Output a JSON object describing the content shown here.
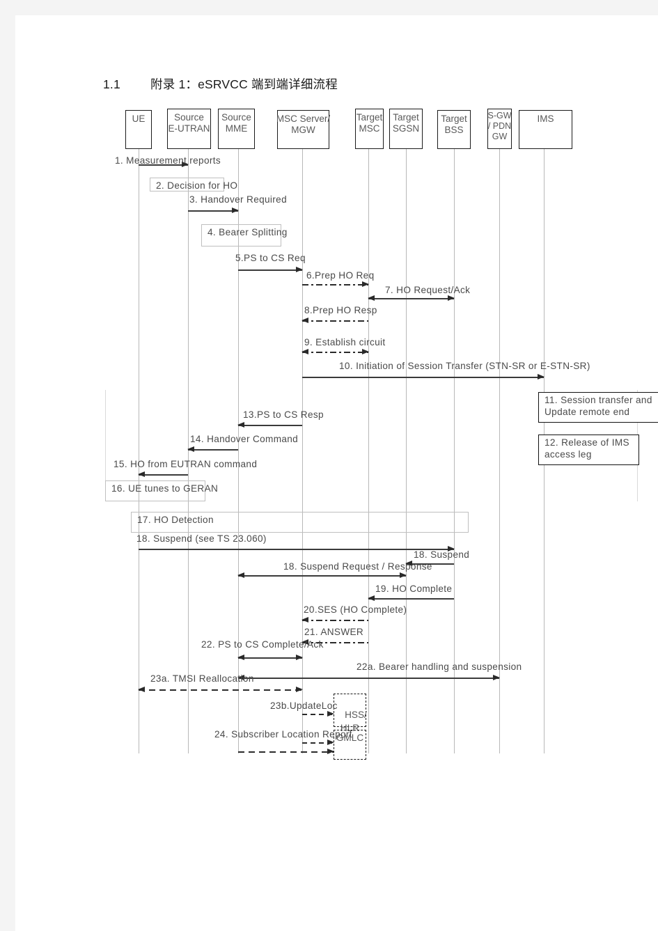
{
  "page": {
    "heading_number": "1.1",
    "heading_text": "附录 1：eSRVCC 端到端详细流程"
  },
  "actors": [
    {
      "name": "ue",
      "label": "UE"
    },
    {
      "name": "source-eutran",
      "label": "Source\nE-UTRAN"
    },
    {
      "name": "source-mme",
      "label": "Source\nMME"
    },
    {
      "name": "msc-server-mgw",
      "label": "MSC Server/\nMGW"
    },
    {
      "name": "target-msc",
      "label": "Target\nMSC"
    },
    {
      "name": "target-sgsn",
      "label": "Target\nSGSN"
    },
    {
      "name": "target-bss",
      "label": "Target\nBSS"
    },
    {
      "name": "sgw-pdngw",
      "label": "S-GW\n/ PDN\nGW"
    },
    {
      "name": "ims",
      "label": "IMS"
    }
  ],
  "extra_nodes": [
    {
      "name": "hss-hlr",
      "label": "HSS/\nHLR"
    },
    {
      "name": "gmlc",
      "label": "GMLC"
    }
  ],
  "messages": [
    {
      "id": "m1",
      "label": "1. Measurement reports"
    },
    {
      "id": "m3",
      "label": "3. Handover Required"
    },
    {
      "id": "m5",
      "label": "5.PS to CS Req"
    },
    {
      "id": "m6",
      "label": "6.Prep HO Req"
    },
    {
      "id": "m7",
      "label": "7. HO Request/Ack"
    },
    {
      "id": "m8",
      "label": "8.Prep HO Resp"
    },
    {
      "id": "m9",
      "label": "9. Establish circuit"
    },
    {
      "id": "m10",
      "label": "10. Initiation of Session Transfer (STN-SR or E-STN-SR)"
    },
    {
      "id": "m13",
      "label": "13.PS to CS Resp"
    },
    {
      "id": "m14",
      "label": "14. Handover Command"
    },
    {
      "id": "m15",
      "label": "15. HO from EUTRAN command"
    },
    {
      "id": "m18a",
      "label": "18. Suspend (see TS 23.060)"
    },
    {
      "id": "m18b",
      "label": "18. Suspend"
    },
    {
      "id": "m18c",
      "label": "18. Suspend Request / Response"
    },
    {
      "id": "m19",
      "label": "19. HO Complete"
    },
    {
      "id": "m20",
      "label": "20.SES (HO Complete)"
    },
    {
      "id": "m21",
      "label": "21. ANSWER"
    },
    {
      "id": "m22",
      "label": "22. PS to CS Complete/Ack"
    },
    {
      "id": "m22a",
      "label": "22a. Bearer handling and suspension"
    },
    {
      "id": "m23a",
      "label": "23a. TMSI Reallocation"
    },
    {
      "id": "m23b",
      "label": "23b.UpdateLoc"
    },
    {
      "id": "m24",
      "label": "24. Subscriber Location Report"
    }
  ],
  "notes": [
    {
      "id": "n2",
      "label": "2. Decision for HO"
    },
    {
      "id": "n4",
      "label": "4. Bearer Splitting"
    },
    {
      "id": "n11",
      "label": "11. Session transfer and Update remote end"
    },
    {
      "id": "n12",
      "label": "12. Release of IMS access leg"
    },
    {
      "id": "n16",
      "label": "16. UE tunes to GERAN"
    },
    {
      "id": "n17",
      "label": "17. HO Detection"
    }
  ],
  "colors": {
    "page_background": "#ffffff",
    "outer_background": "#f4f4f4",
    "actor_border": "#1a1a1a",
    "lifeline": "#b8b8b8",
    "arrow": "#2a2a2a",
    "text": "#4a4a4a",
    "note_border": "#bfbfbf"
  }
}
